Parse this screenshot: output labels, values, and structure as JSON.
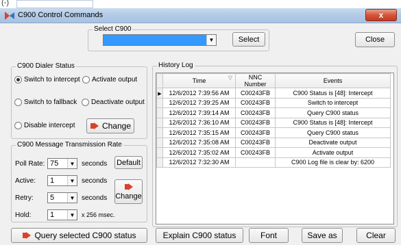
{
  "window": {
    "title": "C900 Control Commands",
    "close_glyph": "x",
    "top_fragment": "(-)"
  },
  "select_group": {
    "legend": "Select C900",
    "combo_value": "",
    "select_label": "Select",
    "close_label": "Close"
  },
  "dialer": {
    "legend": "C900 Dialer Status",
    "options": [
      {
        "label": "Switch to intercept",
        "checked": true
      },
      {
        "label": "Activate output",
        "checked": false
      },
      {
        "label": "Switch to fallback",
        "checked": false
      },
      {
        "label": "Deactivate output",
        "checked": false
      },
      {
        "label": "Disable intercept",
        "checked": false
      }
    ],
    "change_label": "Change"
  },
  "rate": {
    "legend": "C900 Message Transmission Rate",
    "poll_label": "Poll Rate:",
    "poll_value": "75",
    "poll_unit": "seconds",
    "default_label": "Default",
    "active_label": "Active:",
    "active_value": "1",
    "active_unit": "seconds",
    "retry_label": "Retry:",
    "retry_value": "5",
    "retry_unit": "seconds",
    "hold_label": "Hold:",
    "hold_value": "1",
    "hold_unit": "x 256 msec.",
    "change_label": "Change"
  },
  "query_label": "Query selected C900 status",
  "history": {
    "legend": "History Log",
    "columns": [
      "Time",
      "NNC Number",
      "Events"
    ],
    "rows": [
      [
        "12/6/2012 7:39:56 AM",
        "C00243FB",
        "C900 Status is [48]: Intercept"
      ],
      [
        "12/6/2012 7:39:25 AM",
        "C00243FB",
        "Switch to intercept"
      ],
      [
        "12/6/2012 7:39:14 AM",
        "C00243FB",
        "Query C900 status"
      ],
      [
        "12/6/2012 7:36:10 AM",
        "C00243FB",
        "C900 Status is [48]: Intercept"
      ],
      [
        "12/6/2012 7:35:15 AM",
        "C00243FB",
        "Query C900 status"
      ],
      [
        "12/6/2012 7:35:08 AM",
        "C00243FB",
        "Deactivate output"
      ],
      [
        "12/6/2012 7:35:02 AM",
        "C00243FB",
        "Activate output"
      ],
      [
        "12/6/2012 7:32:30 AM",
        "",
        "C900 Log file is clear by: 6200"
      ]
    ]
  },
  "bottom": {
    "explain_label": "Explain C900 status",
    "font_label": "Font",
    "saveas_label": "Save as",
    "clear_label": "Clear"
  },
  "colors": {
    "combo_selection": "#3399ff",
    "change_icon": "#d9432b"
  }
}
